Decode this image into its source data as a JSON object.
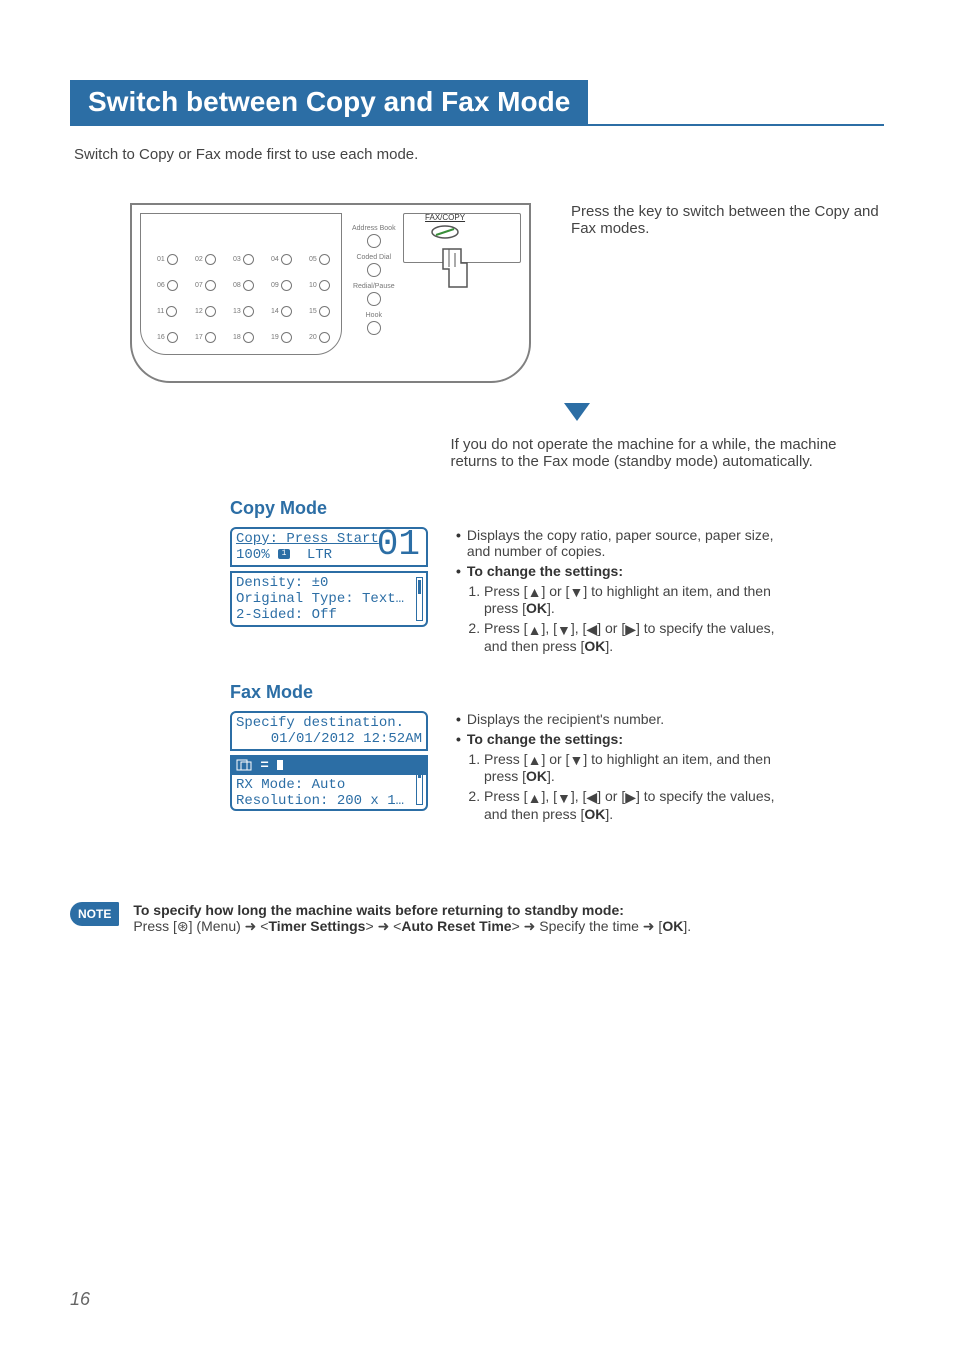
{
  "page_number": "16",
  "heading": "Switch between Copy and Fax Mode",
  "lead": "Switch to Copy or Fax mode first to use each mode.",
  "panel": {
    "side_buttons": [
      "Address Book",
      "Coded Dial",
      "Redial/Pause",
      "Hook"
    ],
    "button_numbers": [
      "01",
      "02",
      "03",
      "04",
      "05",
      "06",
      "07",
      "08",
      "09",
      "10",
      "11",
      "12",
      "13",
      "14",
      "15",
      "16",
      "17",
      "18",
      "19",
      "20"
    ],
    "faxcopy_label": "FAX/COPY",
    "description": "Press the key to switch between the Copy and Fax modes."
  },
  "auto_return_text": "If you do not operate the machine for a while, the machine returns to the Fax mode (standby mode) automatically.",
  "copy_mode": {
    "title": "Copy Mode",
    "top_line1": "Copy: Press Start",
    "top_line2_left": "100%",
    "top_line2_mid": "LTR",
    "big_number": "01",
    "bot_line1": "Density: ±0",
    "bot_line2": "Original Type: Text…",
    "bot_line3": "2-Sided: Off",
    "desc1": "Displays the copy ratio, paper source, paper size, and number of copies.",
    "change_title": "To change the settings:",
    "step1a": "Press [",
    "step1b": "] or [",
    "step1c": "] to highlight an item, and then press [",
    "step1d": "].",
    "ok": "OK",
    "step2a": "Press [",
    "step2b": "], [",
    "step2c": "], [",
    "step2d": "] or [",
    "step2e": "] to specify the values, and then press [",
    "step2f": "]."
  },
  "fax_mode": {
    "title": "Fax Mode",
    "top_line1": "Specify destination.",
    "top_line2": "01/01/2012 12:52AM",
    "bot_line1": "RX Mode: Auto",
    "bot_line2": "Resolution: 200 x 1…",
    "desc1": "Displays the recipient's number.",
    "change_title": "To change the settings:"
  },
  "note": {
    "label": "NOTE",
    "headline": "To specify how long the machine waits before returning to standby mode:",
    "press": "Press [",
    "menu": "] (Menu)",
    "timer": "Timer Settings",
    "auto_reset": "Auto Reset Time",
    "specify": "Specify the time",
    "ok": "OK"
  },
  "icons": {
    "arrow_up": "▲",
    "arrow_down": "▼",
    "arrow_left": "◀",
    "arrow_right": "▶",
    "fat_arrow": "➜",
    "menu_icon": "⊛"
  }
}
